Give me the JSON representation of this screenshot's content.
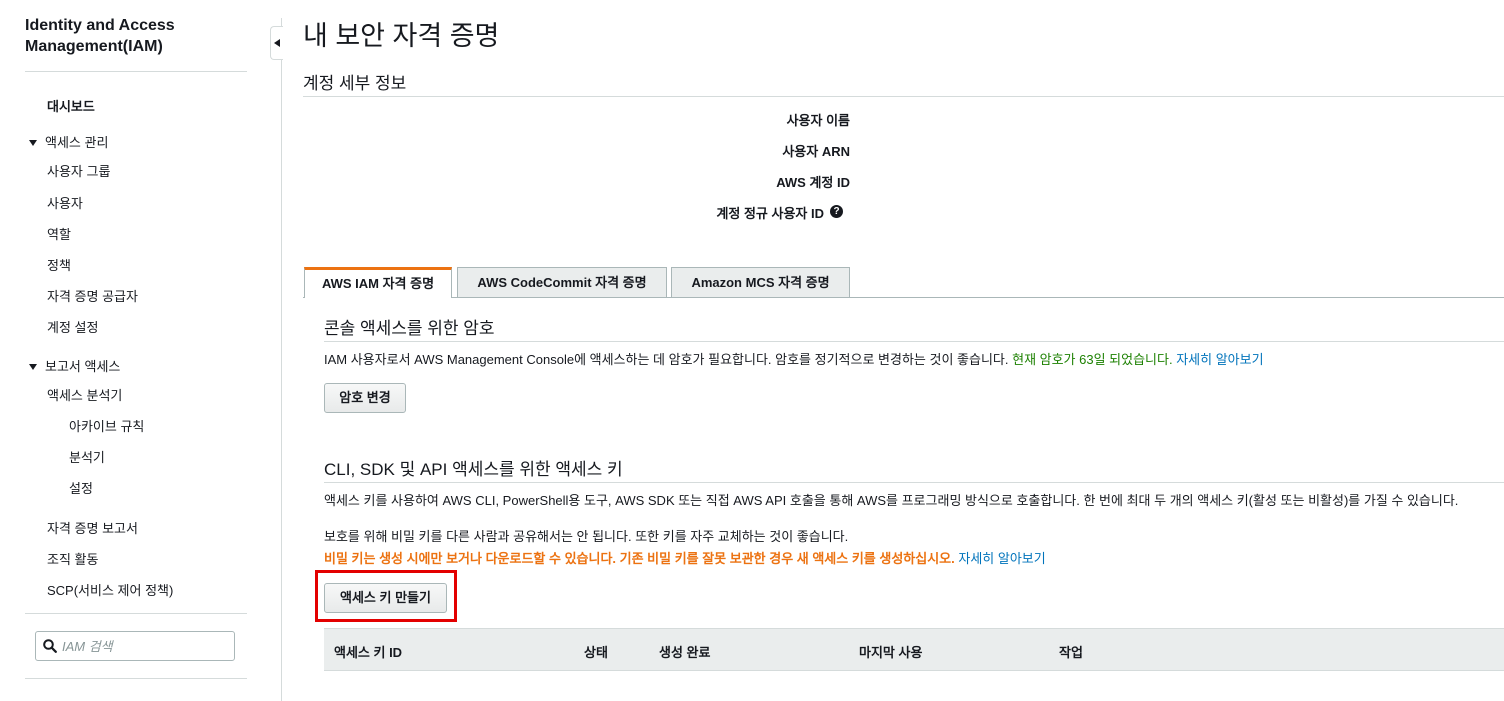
{
  "sidebar": {
    "title_line1": "Identity and Access",
    "title_line2": "Management(IAM)",
    "dashboard": "대시보드",
    "access_management": {
      "label": "액세스 관리",
      "items": [
        "사용자 그룹",
        "사용자",
        "역할",
        "정책",
        "자격 증명 공급자",
        "계정 설정"
      ]
    },
    "access_reports": {
      "label": "보고서 액세스",
      "analyzer": "액세스 분석기",
      "analyzer_items": [
        "아카이브 규칙",
        "분석기",
        "설정"
      ],
      "items": [
        "자격 증명 보고서",
        "조직 활동",
        "SCP(서비스 제어 정책)"
      ]
    },
    "search_placeholder": "IAM 검색"
  },
  "page": {
    "title": "내 보안 자격 증명",
    "account_details_heading": "계정 세부 정보",
    "details": {
      "username_label": "사용자 이름",
      "user_arn_label": "사용자 ARN",
      "account_id_label": "AWS 계정 ID",
      "canonical_id_label": "계정 정규 사용자 ID",
      "help_glyph": "?"
    }
  },
  "tabs": [
    {
      "label": "AWS IAM 자격 증명",
      "active": true
    },
    {
      "label": "AWS CodeCommit 자격 증명",
      "active": false
    },
    {
      "label": "Amazon MCS 자격 증명",
      "active": false
    }
  ],
  "console_section": {
    "title": "콘솔 액세스를 위한 암호",
    "text": "IAM 사용자로서 AWS Management Console에 액세스하는 데 암호가 필요합니다. 암호를 정기적으로 변경하는 것이 좋습니다.",
    "status": "현재 암호가 63일 되었습니다.",
    "link": "자세히 알아보기",
    "button": "암호 변경"
  },
  "keys_section": {
    "title": "CLI, SDK 및 API 액세스를 위한 액세스 키",
    "text1": "액세스 키를 사용하여 AWS CLI, PowerShell용 도구, AWS SDK 또는 직접 AWS API 호출을 통해 AWS를 프로그래밍 방식으로 호출합니다. 한 번에 최대 두 개의 액세스 키(활성 또는 비활성)를 가질 수 있습니다.",
    "text2": "보호를 위해 비밀 키를 다른 사람과 공유해서는 안 됩니다. 또한 키를 자주 교체하는 것이 좋습니다.",
    "warning": "비밀 키는 생성 시에만 보거나 다운로드할 수 있습니다. 기존 비밀 키를 잘못 보관한 경우 새 액세스 키를 생성하십시오.",
    "link": "자세히 알아보기",
    "button": "액세스 키 만들기",
    "columns": [
      "액세스 키 ID",
      "상태",
      "생성 완료",
      "마지막 사용",
      "작업"
    ]
  },
  "colors": {
    "accent_tab": "#ec7211",
    "link": "#0073bb",
    "success": "#1d8102",
    "warning": "#ec7211",
    "highlight_box": "#e30000"
  }
}
